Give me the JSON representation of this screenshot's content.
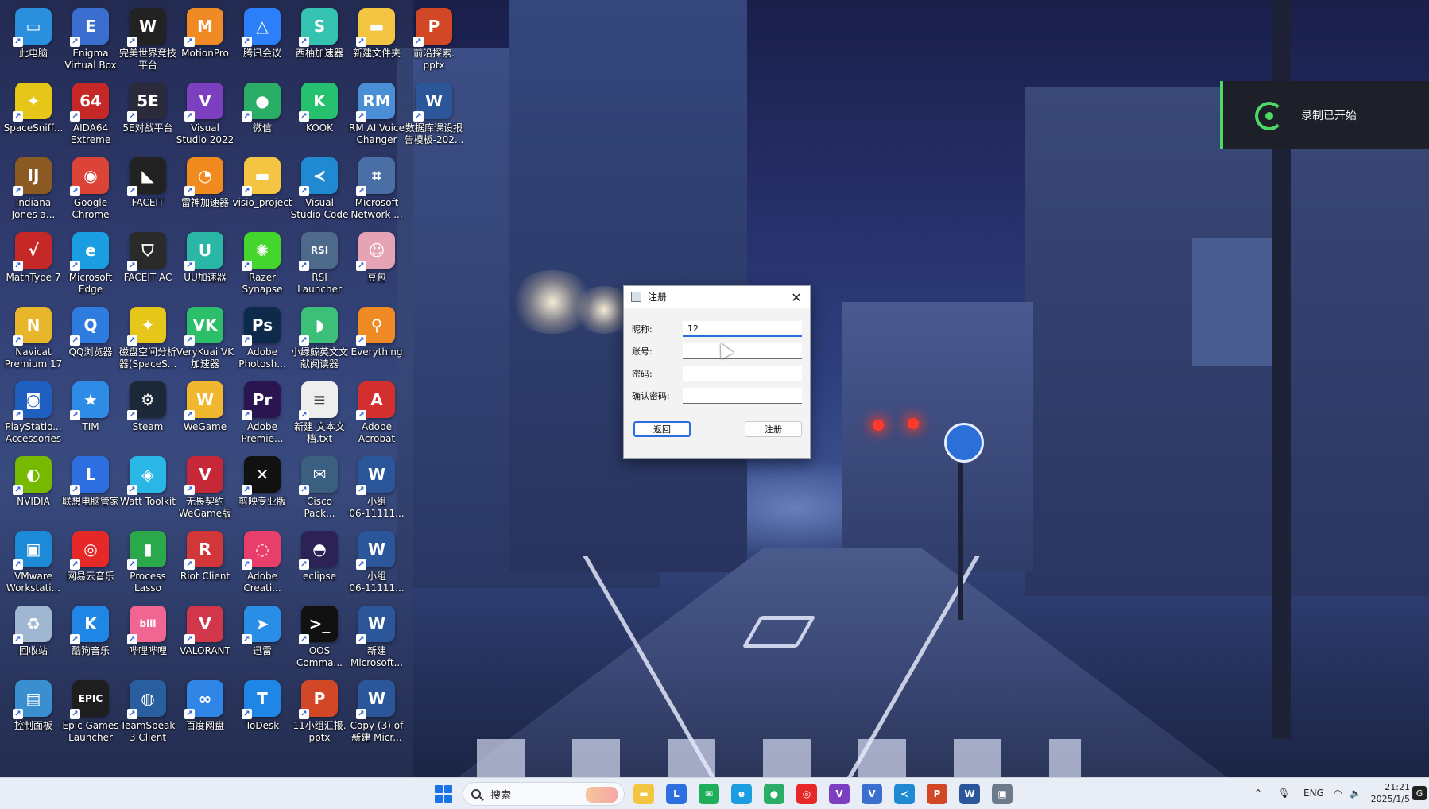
{
  "desktop": {
    "icons": [
      {
        "label": "此电脑",
        "color": "#2a8fdc",
        "glyph": "▭",
        "icon": "computer-icon"
      },
      {
        "label": "Enigma\nVirtual Box",
        "color": "#3a6fd0",
        "glyph": "E",
        "icon": "enigma-icon"
      },
      {
        "label": "完美世界竞技\n平台",
        "color": "#222222",
        "glyph": "W",
        "icon": "perfect-world-icon"
      },
      {
        "label": "MotionPro",
        "color": "#f08a24",
        "glyph": "M",
        "icon": "motionpro-icon"
      },
      {
        "label": "腾讯会议",
        "color": "#2d7ff9",
        "glyph": "△",
        "icon": "tencent-meeting-icon"
      },
      {
        "label": "西柚加速器",
        "color": "#34c3b0",
        "glyph": "S",
        "icon": "xiyou-icon"
      },
      {
        "label": "新建文件夹",
        "color": "#f4c542",
        "glyph": "▬",
        "icon": "folder-icon"
      },
      {
        "label": "前沿探索.\npptx",
        "color": "#d24726",
        "glyph": "P",
        "icon": "pptx-icon"
      },
      {
        "label": "SpaceSniff...",
        "color": "#e6c619",
        "glyph": "✦",
        "icon": "spacesniffer-icon"
      },
      {
        "label": "AIDA64\nExtreme",
        "color": "#c62828",
        "glyph": "64",
        "icon": "aida64-icon"
      },
      {
        "label": "5E对战平台",
        "color": "#2a2a3a",
        "glyph": "5E",
        "icon": "5e-icon"
      },
      {
        "label": "Visual\nStudio 2022",
        "color": "#7b3fbf",
        "glyph": "V",
        "icon": "visual-studio-icon"
      },
      {
        "label": "微信",
        "color": "#2aae67",
        "glyph": "●",
        "icon": "wechat-icon"
      },
      {
        "label": "KOOK",
        "color": "#25c16f",
        "glyph": "K",
        "icon": "kook-icon"
      },
      {
        "label": "RM AI Voice\nChanger",
        "color": "#4a8fd6",
        "glyph": "RM",
        "icon": "voice-changer-icon"
      },
      {
        "label": "数据库课设报\n告模板-202...",
        "color": "#2b579a",
        "glyph": "W",
        "icon": "word-icon"
      },
      {
        "label": "Indiana\nJones a...",
        "color": "#8a5a22",
        "glyph": "IJ",
        "icon": "indiana-jones-icon"
      },
      {
        "label": "Google\nChrome",
        "color": "#db4437",
        "glyph": "◉",
        "icon": "chrome-icon"
      },
      {
        "label": "FACEIT",
        "color": "#222222",
        "glyph": "◣",
        "icon": "faceit-icon"
      },
      {
        "label": "雷神加速器",
        "color": "#f28b1f",
        "glyph": "◔",
        "icon": "leishen-icon"
      },
      {
        "label": "visio_project",
        "color": "#f4c542",
        "glyph": "▬",
        "icon": "folder-icon"
      },
      {
        "label": "Visual\nStudio Code",
        "color": "#1f8ad2",
        "glyph": "≺",
        "icon": "vscode-icon"
      },
      {
        "label": "Microsoft\nNetwork ...",
        "color": "#4a6fa5",
        "glyph": "⌗",
        "icon": "network-icon"
      },
      {
        "label": "MathType 7",
        "color": "#c62828",
        "glyph": "√",
        "icon": "mathtype-icon"
      },
      {
        "label": "Microsoft\nEdge",
        "color": "#1b9de2",
        "glyph": "e",
        "icon": "edge-icon"
      },
      {
        "label": "FACEIT AC",
        "color": "#2a2a2a",
        "glyph": "⛉",
        "icon": "faceit-ac-icon"
      },
      {
        "label": "UU加速器",
        "color": "#2bb7a6",
        "glyph": "U",
        "icon": "uu-icon"
      },
      {
        "label": "Razer\nSynapse",
        "color": "#44d62c",
        "glyph": "✺",
        "icon": "razer-icon"
      },
      {
        "label": "RSI\nLauncher",
        "color": "#4d6a8a",
        "glyph": "RSI",
        "icon": "rsi-icon"
      },
      {
        "label": "豆包",
        "color": "#e7a3b6",
        "glyph": "☺",
        "icon": "doubao-icon"
      },
      {
        "label": "Navicat\nPremium 17",
        "color": "#e8b62a",
        "glyph": "N",
        "icon": "navicat-icon"
      },
      {
        "label": "QQ浏览器",
        "color": "#2f7ce0",
        "glyph": "Q",
        "icon": "qq-browser-icon"
      },
      {
        "label": "磁盘空间分析\n器(SpaceS...",
        "color": "#e6c619",
        "glyph": "✦",
        "icon": "disk-analyzer-icon"
      },
      {
        "label": "VeryKuai VK\n加速器",
        "color": "#2bbf6a",
        "glyph": "VK",
        "icon": "verykuai-icon"
      },
      {
        "label": "Adobe\nPhotosh...",
        "color": "#0d2a4a",
        "glyph": "Ps",
        "icon": "photoshop-icon"
      },
      {
        "label": "小绿鲸英文文\n献阅读器",
        "color": "#3bbf79",
        "glyph": "◗",
        "icon": "reader-icon"
      },
      {
        "label": "Everything",
        "color": "#f08a24",
        "glyph": "⚲",
        "icon": "everything-icon"
      },
      {
        "label": "PlayStatio...\nAccessories",
        "color": "#1f5fbf",
        "glyph": "◙",
        "icon": "playstation-icon"
      },
      {
        "label": "TIM",
        "color": "#2f8ce6",
        "glyph": "★",
        "icon": "tim-icon"
      },
      {
        "label": "Steam",
        "color": "#1b2838",
        "glyph": "⚙",
        "icon": "steam-icon"
      },
      {
        "label": "WeGame",
        "color": "#f0b72f",
        "glyph": "W",
        "icon": "wegame-icon"
      },
      {
        "label": "Adobe\nPremie...",
        "color": "#2a1550",
        "glyph": "Pr",
        "icon": "premiere-icon"
      },
      {
        "label": "新建 文本文\n档.txt",
        "color": "#eeeeee",
        "glyph": "≡",
        "icon": "text-file-icon"
      },
      {
        "label": "Adobe\nAcrobat",
        "color": "#d32f2f",
        "glyph": "A",
        "icon": "acrobat-icon"
      },
      {
        "label": "NVIDIA",
        "color": "#76b900",
        "glyph": "◐",
        "icon": "nvidia-icon"
      },
      {
        "label": "联想电脑管家",
        "color": "#2d6fe0",
        "glyph": "L",
        "icon": "lenovo-icon"
      },
      {
        "label": "Watt Toolkit",
        "color": "#2bb7e6",
        "glyph": "◈",
        "icon": "watt-icon"
      },
      {
        "label": "无畏契约\nWeGame版",
        "color": "#c62838",
        "glyph": "V",
        "icon": "valorant-wegame-icon"
      },
      {
        "label": "剪映专业版",
        "color": "#111111",
        "glyph": "✕",
        "icon": "capcut-icon"
      },
      {
        "label": "Cisco\nPack...",
        "color": "#3b5f7f",
        "glyph": "✉",
        "icon": "cisco-icon"
      },
      {
        "label": "小组\n06-11111...",
        "color": "#2b579a",
        "glyph": "W",
        "icon": "word-icon"
      },
      {
        "label": "VMware\nWorkstati...",
        "color": "#1c8ad6",
        "glyph": "▣",
        "icon": "vmware-icon"
      },
      {
        "label": "网易云音乐",
        "color": "#e62828",
        "glyph": "◎",
        "icon": "netease-music-icon"
      },
      {
        "label": "Process\nLasso",
        "color": "#2aa84a",
        "glyph": "▮",
        "icon": "process-lasso-icon"
      },
      {
        "label": "Riot Client",
        "color": "#d13639",
        "glyph": "R",
        "icon": "riot-icon"
      },
      {
        "label": "Adobe\nCreati...",
        "color": "#e83e6b",
        "glyph": "◌",
        "icon": "creative-cloud-icon"
      },
      {
        "label": "eclipse",
        "color": "#2c2255",
        "glyph": "◓",
        "icon": "eclipse-icon"
      },
      {
        "label": "小组\n06-11111...",
        "color": "#2b579a",
        "glyph": "W",
        "icon": "word-icon"
      },
      {
        "label": "回收站",
        "color": "#9fb7d1",
        "glyph": "♻",
        "icon": "recycle-bin-icon"
      },
      {
        "label": "酷狗音乐",
        "color": "#1f86e6",
        "glyph": "K",
        "icon": "kugou-icon"
      },
      {
        "label": "哔哩哔哩",
        "color": "#f06592",
        "glyph": "bili",
        "icon": "bilibili-icon"
      },
      {
        "label": "VALORANT",
        "color": "#d1364a",
        "glyph": "V",
        "icon": "valorant-icon"
      },
      {
        "label": "迅雷",
        "color": "#2a8ee6",
        "glyph": "➤",
        "icon": "xunlei-icon"
      },
      {
        "label": "OOS\nComma...",
        "color": "#111111",
        "glyph": ">_",
        "icon": "terminal-icon"
      },
      {
        "label": "新建\nMicrosoft...",
        "color": "#2b579a",
        "glyph": "W",
        "icon": "word-icon"
      },
      {
        "label": "控制面板",
        "color": "#3a8fd0",
        "glyph": "▤",
        "icon": "control-panel-icon"
      },
      {
        "label": "Epic Games\nLauncher",
        "color": "#1e1e1e",
        "glyph": "EPIC",
        "icon": "epic-icon"
      },
      {
        "label": "TeamSpeak\n3 Client",
        "color": "#2a5f9f",
        "glyph": "◍",
        "icon": "teamspeak-icon"
      },
      {
        "label": "百度网盘",
        "color": "#2f86e6",
        "glyph": "∞",
        "icon": "baidu-netdisk-icon"
      },
      {
        "label": "ToDesk",
        "color": "#1f86e6",
        "glyph": "T",
        "icon": "todesk-icon"
      },
      {
        "label": "11小组汇报.\npptx",
        "color": "#d24726",
        "glyph": "P",
        "icon": "pptx-icon"
      },
      {
        "label": "Copy (3) of\n新建 Micr...",
        "color": "#2b579a",
        "glyph": "W",
        "icon": "word-icon"
      }
    ]
  },
  "recording_toast": {
    "text": "录制已开始",
    "accent": "#4cd964"
  },
  "dialog": {
    "title": "注册",
    "fields": [
      {
        "label": "昵称:",
        "value": "12",
        "placeholder": ""
      },
      {
        "label": "账号:",
        "value": "",
        "placeholder": ""
      },
      {
        "label": "密码:",
        "value": "",
        "placeholder": ""
      },
      {
        "label": "确认密码:",
        "value": "",
        "placeholder": ""
      }
    ],
    "back_label": "返回",
    "register_label": "注册"
  },
  "taskbar": {
    "search_placeholder": "搜索",
    "language": "ENG",
    "time": "21:21",
    "date": "2025/1/5",
    "apps": [
      {
        "name": "file-explorer-icon",
        "color": "#f4c542",
        "glyph": "▬"
      },
      {
        "name": "lenovo-taskbar-icon",
        "color": "#2d6fe0",
        "glyph": "L"
      },
      {
        "name": "green-app-icon",
        "color": "#1fae5a",
        "glyph": "✉"
      },
      {
        "name": "edge-taskbar-icon",
        "color": "#1b9de2",
        "glyph": "e"
      },
      {
        "name": "wechat-taskbar-icon",
        "color": "#2aae67",
        "glyph": "●"
      },
      {
        "name": "netease-taskbar-icon",
        "color": "#e62828",
        "glyph": "◎"
      },
      {
        "name": "visual-studio-taskbar-icon",
        "color": "#7b3fbf",
        "glyph": "V"
      },
      {
        "name": "vs-blue-taskbar-icon",
        "color": "#3a6fd0",
        "glyph": "V"
      },
      {
        "name": "vscode-taskbar-icon",
        "color": "#1f8ad2",
        "glyph": "≺"
      },
      {
        "name": "powerpoint-taskbar-icon",
        "color": "#d24726",
        "glyph": "P"
      },
      {
        "name": "word-taskbar-icon",
        "color": "#2b579a",
        "glyph": "W"
      },
      {
        "name": "window-app-taskbar-icon",
        "color": "#6b7b8c",
        "glyph": "▣"
      }
    ]
  }
}
